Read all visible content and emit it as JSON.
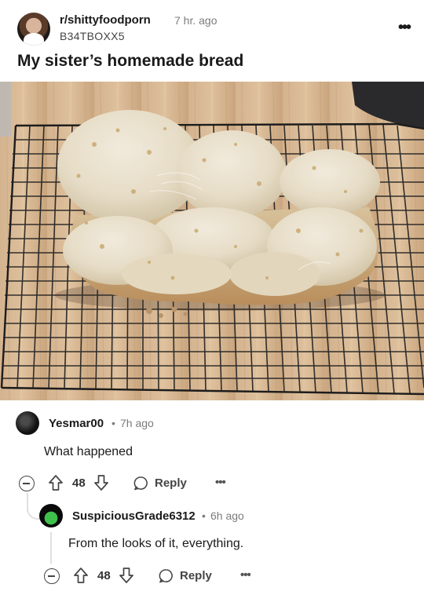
{
  "post": {
    "subreddit": "r/shittyfoodporn",
    "time": "7 hr. ago",
    "author": "B34TBOXX5",
    "title": "My sister’s homemade bread",
    "more_icon": "kebab-icon"
  },
  "comments": [
    {
      "author": "Yesmar00",
      "dot": "•",
      "time": "7h ago",
      "body": "What happened",
      "score": "48",
      "reply_label": "Reply",
      "more": "•••"
    },
    {
      "author": "SuspiciousGrade6312",
      "dot": "•",
      "time": "6h ago",
      "body": "From the looks of it, everything.",
      "score": "48",
      "reply_label": "Reply",
      "more": "•••"
    }
  ],
  "colors": {
    "text": "#1a1a1b",
    "muted": "#7c7c7c",
    "thread": "#e0e0e0"
  }
}
